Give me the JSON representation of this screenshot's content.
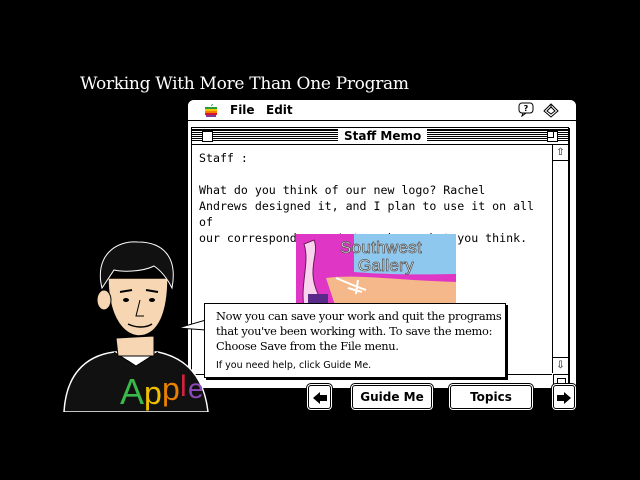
{
  "lesson": {
    "title": "Working With More Than One Program"
  },
  "menubar": {
    "apple_icon": "apple-menu-icon",
    "items": [
      {
        "label": "File"
      },
      {
        "label": "Edit"
      }
    ],
    "help_icon": "balloon-help-icon",
    "app_icon": "application-menu-icon"
  },
  "window": {
    "title": "Staff Memo",
    "body": {
      "greeting": "Staff :",
      "line1": "What do you think of our new logo?  Rachel",
      "line2": "Andrews designed it, and I plan to use it on all of",
      "line3": "our correspondence.  Let me know what you think."
    },
    "logo": {
      "line1": "Southwest",
      "line2": "Gallery"
    }
  },
  "balloon": {
    "line1": "Now you can save your work and quit the programs",
    "line2": "that you've been working with.   To save the memo:",
    "line3": "Choose Save from the File menu.",
    "hint": "If you need help, click Guide Me."
  },
  "nav": {
    "back_icon": "left-arrow-icon",
    "guide_me": "Guide Me",
    "topics": "Topics",
    "next_icon": "right-arrow-icon"
  },
  "colors": {
    "background": "#000000",
    "logo_sky": "#8fc8ee",
    "logo_magenta": "#e036c6",
    "logo_sand": "#f4b88a"
  }
}
